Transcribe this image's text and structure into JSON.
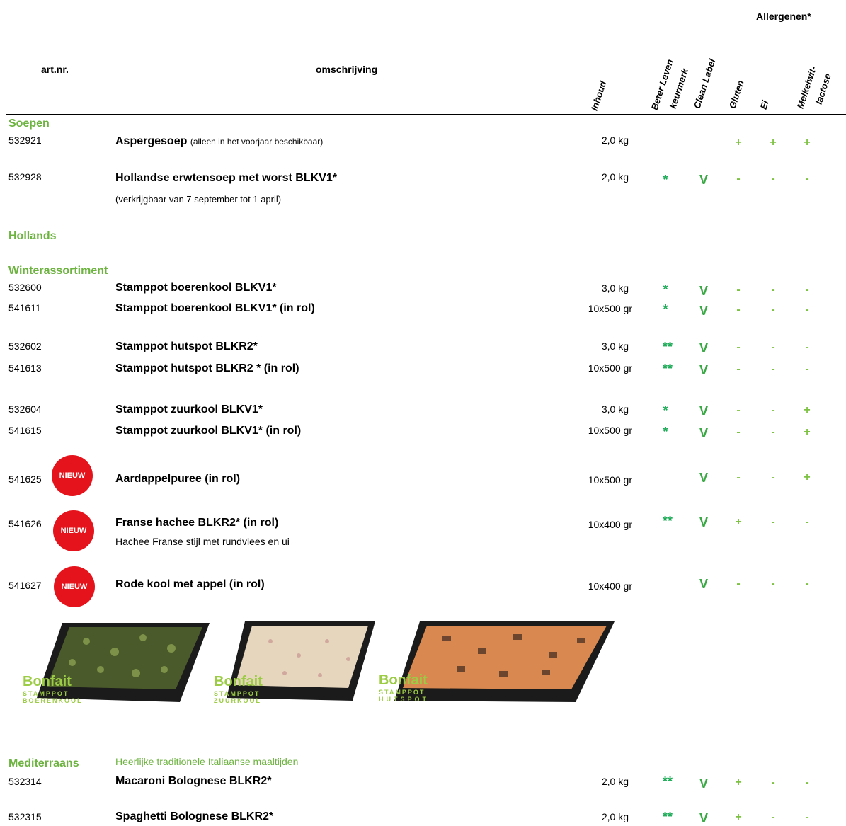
{
  "header": {
    "allergens_title": "Allergenen*",
    "col_art": "art.nr.",
    "col_desc": "omschrijving",
    "col_inhoud": "Inhoud",
    "col_beter1": "Beter Leven",
    "col_beter2": "keurmerk",
    "col_clean": "Clean Label",
    "col_gluten": "Gluten",
    "col_ei": "Ei",
    "col_melk1": "Melkeiwit-",
    "col_melk2": "lactose"
  },
  "sections": {
    "soepen": "Soepen",
    "hollands": "Hollands",
    "winter": "Winterassortiment",
    "mediterraans": "Mediterraans",
    "mediterraans_tagline": "Heerlijke traditionele Italiaanse maaltijden"
  },
  "badge_label": "NIEUW",
  "colors": {
    "accent_green": "#6cb33f",
    "mark_green": "#3aa845",
    "badge_red": "#e5141c"
  },
  "rows": [
    {
      "art": "532921",
      "name": "Aspergesoep",
      "note": "(alleen in het voorjaar beschikbaar)",
      "qty": "2,0 kg",
      "beter": "",
      "clean": "",
      "gluten": "+",
      "ei": "+",
      "melk": "+"
    },
    {
      "art": "532928",
      "name": "Hollandse erwtensoep met worst BLKV1*",
      "sub": "(verkrijgbaar van 7 september tot 1 april)",
      "qty": "2,0 kg",
      "beter": "*",
      "clean": "V",
      "gluten": "-",
      "ei": "-",
      "melk": "-"
    },
    {
      "art": "532600",
      "name": "Stamppot boerenkool BLKV1*",
      "qty": "3,0 kg",
      "beter": "*",
      "clean": "V",
      "gluten": "-",
      "ei": "-",
      "melk": "-"
    },
    {
      "art": "541611",
      "name": "Stamppot boerenkool BLKV1* (in rol)",
      "qty": "10x500 gr",
      "beter": "*",
      "clean": "V",
      "gluten": "-",
      "ei": "-",
      "melk": "-"
    },
    {
      "art": "532602",
      "name": "Stamppot hutspot BLKR2*",
      "qty": "3,0 kg",
      "beter": "**",
      "clean": "V",
      "gluten": "-",
      "ei": "-",
      "melk": "-"
    },
    {
      "art": "541613",
      "name": "Stamppot hutspot BLKR2 * (in rol)",
      "qty": "10x500 gr",
      "beter": "**",
      "clean": "V",
      "gluten": "-",
      "ei": "-",
      "melk": "-"
    },
    {
      "art": "532604",
      "name": "Stamppot zuurkool BLKV1*",
      "qty": "3,0 kg",
      "beter": "*",
      "clean": "V",
      "gluten": "-",
      "ei": "-",
      "melk": "+"
    },
    {
      "art": "541615",
      "name": "Stamppot zuurkool BLKV1* (in rol)",
      "qty": "10x500 gr",
      "beter": "*",
      "clean": "V",
      "gluten": "-",
      "ei": "-",
      "melk": "+"
    },
    {
      "art": "541625",
      "name": "Aardappelpuree (in rol)",
      "qty": "10x500 gr",
      "beter": "",
      "clean": "V",
      "gluten": "-",
      "ei": "-",
      "melk": "+"
    },
    {
      "art": "541626",
      "name": "Franse hachee BLKR2* (in rol)",
      "sub": "Hachee Franse stijl met rundvlees en ui",
      "qty": "10x400 gr",
      "beter": "**",
      "clean": "V",
      "gluten": "+",
      "ei": "-",
      "melk": "-"
    },
    {
      "art": "541627",
      "name": "Rode kool met appel (in rol)",
      "qty": "10x400 gr",
      "beter": "",
      "clean": "V",
      "gluten": "-",
      "ei": "-",
      "melk": "-"
    },
    {
      "art": "532314",
      "name": "Macaroni Bolognese BLKR2*",
      "qty": "2,0 kg",
      "beter": "**",
      "clean": "V",
      "gluten": "+",
      "ei": "-",
      "melk": "-"
    },
    {
      "art": "532315",
      "name": "Spaghetti Bolognese BLKR2*",
      "qty": "2,0 kg",
      "beter": "**",
      "clean": "V",
      "gluten": "+",
      "ei": "-",
      "melk": "-"
    }
  ],
  "products": [
    {
      "brand": "Bonfait",
      "line1": "STAMPPOT",
      "line2": "BOERENKOOL"
    },
    {
      "brand": "Bonfait",
      "line1": "STAMPPOT",
      "line2": "ZUURKOOL"
    },
    {
      "brand": "Bonfait",
      "line1": "STAMPPOT",
      "line2": "HUTSPOT"
    }
  ]
}
